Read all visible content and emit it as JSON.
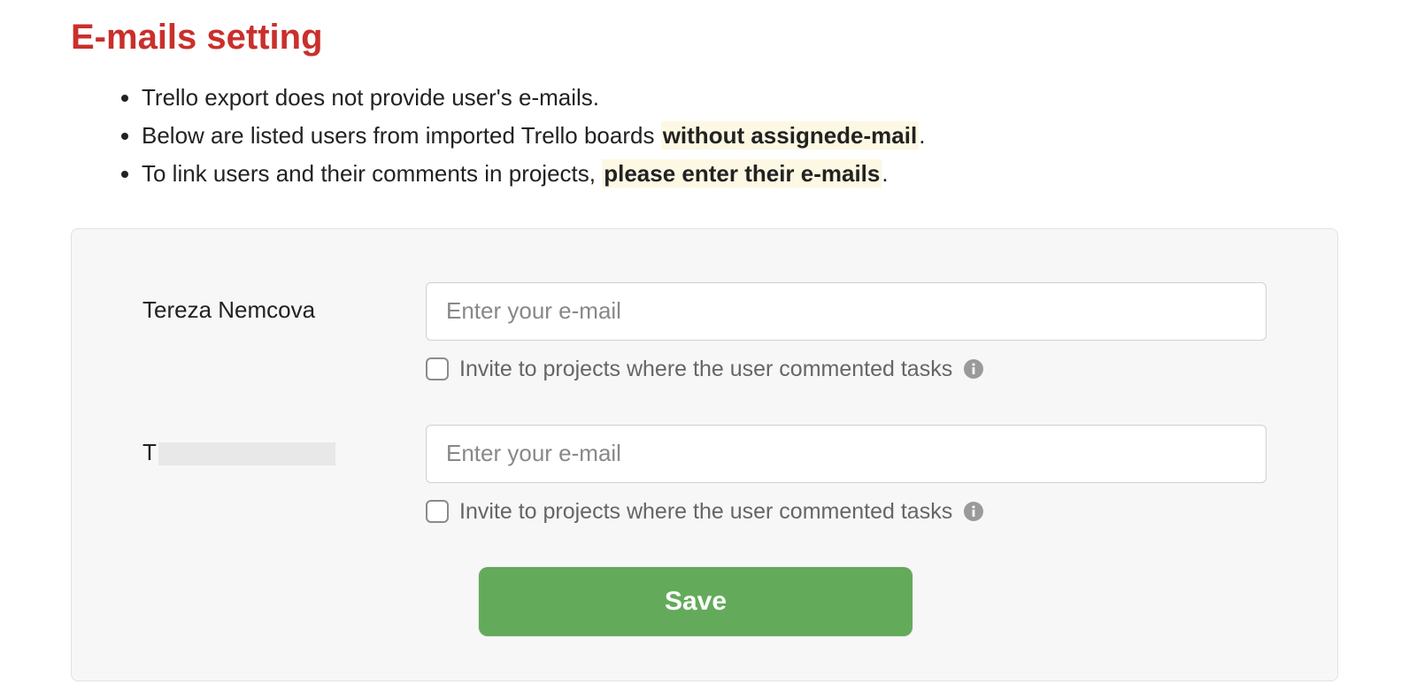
{
  "header": {
    "title": "E-mails setting"
  },
  "bullets": {
    "item1": "Trello export does not provide user's e-mails.",
    "item2_prefix": "Below are listed users from imported Trello boards ",
    "item2_highlight": "without assignede-mail",
    "item2_suffix": ".",
    "item3_prefix": "To link users and their comments in projects, ",
    "item3_highlight": "please enter their e-mails",
    "item3_suffix": "."
  },
  "form": {
    "placeholder": "Enter your e-mail",
    "checkbox_label": "Invite to projects where the user commented tasks",
    "save_label": "Save"
  },
  "users": [
    {
      "name": "Tereza Nemcova",
      "redacted": false
    },
    {
      "name": "T",
      "redacted": true
    }
  ]
}
